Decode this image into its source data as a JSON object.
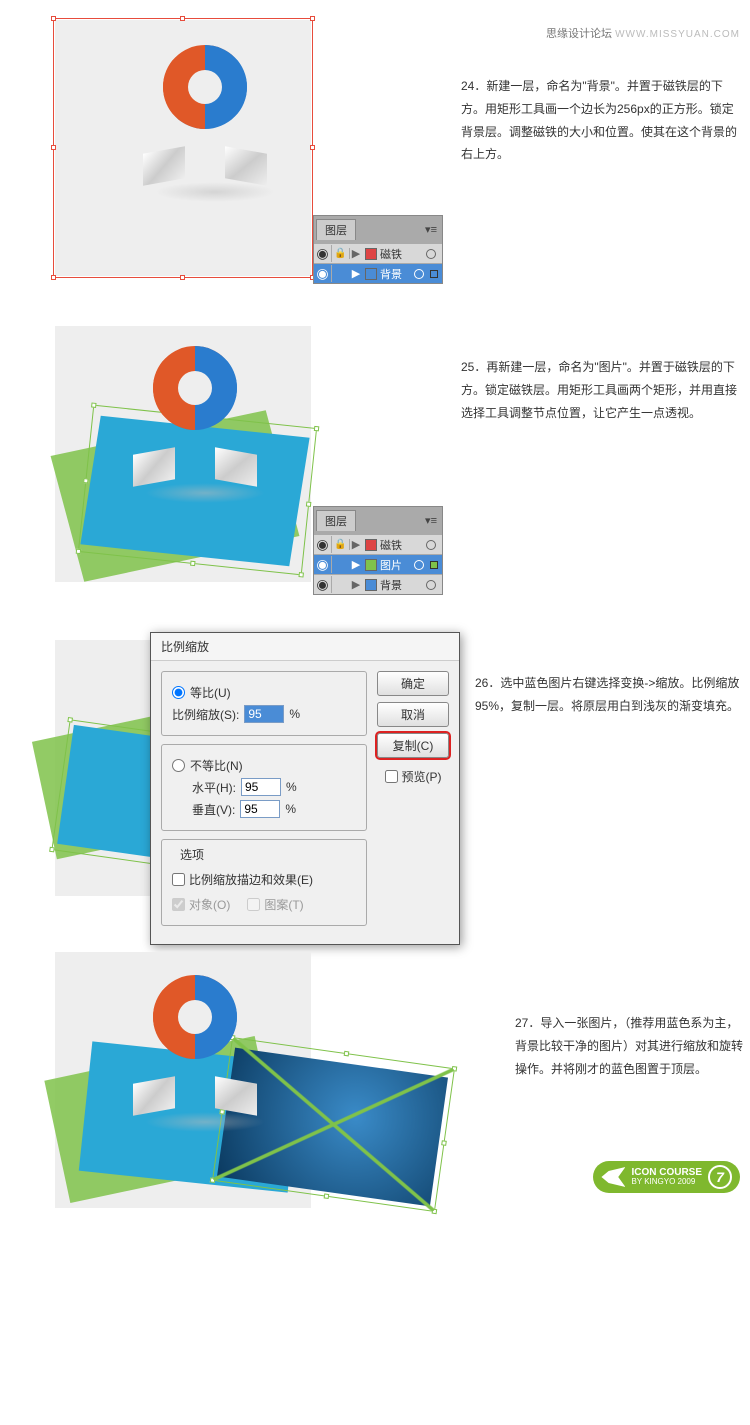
{
  "header": {
    "cn": "思缘设计论坛",
    "en": "WWW.MISSYUAN.COM"
  },
  "steps": {
    "s24": {
      "num": "24．",
      "text": "新建一层，命名为\"背景\"。并置于磁铁层的下方。用矩形工具画一个边长为256px的正方形。锁定背景层。调整磁铁的大小和位置。使其在这个背景的右上方。"
    },
    "s25": {
      "num": "25．",
      "text": "再新建一层，命名为\"图片\"。并置于磁铁层的下方。锁定磁铁层。用矩形工具画两个矩形，并用直接选择工具调整节点位置，让它产生一点透视。"
    },
    "s26": {
      "num": "26．",
      "text": "选中蓝色图片右键选择变换->缩放。比例缩放95%，复制一层。将原层用白到浅灰的渐变填充。"
    },
    "s27": {
      "num": "27．",
      "text": "导入一张图片，（推荐用蓝色系为主，背景比较干净的图片）对其进行缩放和旋转操作。并将刚才的蓝色图置于顶层。"
    }
  },
  "layers": {
    "tab": "图层",
    "magnet": "磁铁",
    "background": "背景",
    "image": "图片"
  },
  "dialog": {
    "title": "比例缩放",
    "uniform": "等比(U)",
    "scale_label": "比例缩放(S):",
    "scale_val": "95",
    "pct": "%",
    "nonuniform": "不等比(N)",
    "horiz": "水平(H):",
    "horiz_val": "95",
    "vert": "垂直(V):",
    "vert_val": "95",
    "options": "选项",
    "scale_strokes": "比例缩放描边和效果(E)",
    "objects": "对象(O)",
    "patterns": "图案(T)",
    "ok": "确定",
    "cancel": "取消",
    "copy": "复制(C)",
    "preview": "预览(P)"
  },
  "footer": {
    "title": "ICON COURSE",
    "sub": "BY KINGYO 2009",
    "page": "7"
  }
}
